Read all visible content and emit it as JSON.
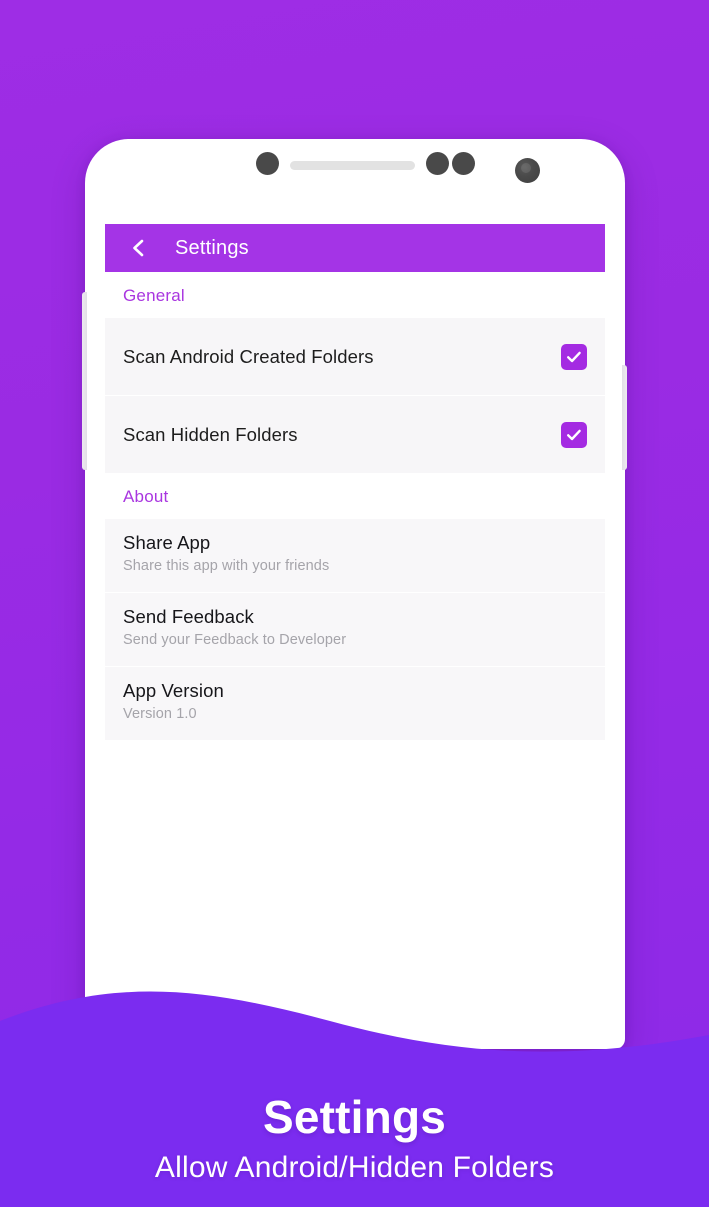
{
  "background": {
    "top_color": "#9C2CE4",
    "bottom_color": "#7B2CF0",
    "accent_color": "#A434E6"
  },
  "device": {
    "frame_color": "#FFFFFF",
    "hardware": {
      "sensor_dot_left": "sensor-dot",
      "speaker_grille": "speaker-bar",
      "sensor_dot_a": "sensor-dot",
      "sensor_dot_b": "sensor-dot",
      "front_camera": "camera-lens",
      "volume_button": "volume-rocker",
      "power_button": "power-button"
    }
  },
  "app": {
    "app_bar": {
      "back_icon": "chevron-left-icon",
      "title": "Settings",
      "background_color": "#A434E6",
      "title_color": "#FFFFFF"
    },
    "sections": [
      {
        "header": "General",
        "header_color": "#A936E0",
        "type": "toggles",
        "rows": [
          {
            "title": "Scan Android Created Folders",
            "control": "checkbox",
            "checked": true,
            "check_icon": "check-icon"
          },
          {
            "title": "Scan Hidden Folders",
            "control": "checkbox",
            "checked": true,
            "check_icon": "check-icon"
          }
        ]
      },
      {
        "header": "About",
        "header_color": "#A936E0",
        "type": "info",
        "rows": [
          {
            "title": "Share App",
            "subtitle": "Share this app with your friends"
          },
          {
            "title": "Send Feedback",
            "subtitle": "Send your Feedback to Developer"
          },
          {
            "title": "App Version",
            "subtitle": "Version 1.0"
          }
        ]
      }
    ]
  },
  "caption": {
    "title": "Settings",
    "subtitle": "Allow Android/Hidden Folders"
  }
}
